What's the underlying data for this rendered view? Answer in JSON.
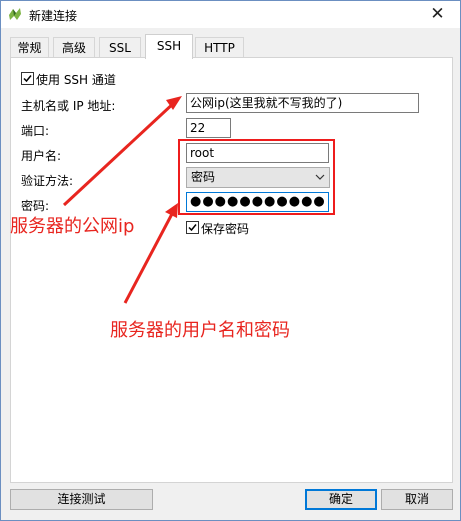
{
  "window": {
    "title": "新建连接",
    "close_glyph": "✕"
  },
  "tabs": [
    {
      "label": "常规"
    },
    {
      "label": "高级"
    },
    {
      "label": "SSL"
    },
    {
      "label": "SSH"
    },
    {
      "label": "HTTP"
    }
  ],
  "active_tab": "SSH",
  "ssh": {
    "use_ssh_label": "使用 SSH 通道",
    "use_ssh_checked": true,
    "host_label": "主机名或 IP 地址:",
    "host_value": "公网ip(这里我就不写我的了)",
    "port_label": "端口:",
    "port_value": "22",
    "username_label": "用户名:",
    "username_value": "root",
    "auth_label": "验证方法:",
    "auth_value": "密码",
    "password_label": "密码:",
    "password_value": "●●●●●●●●●●●",
    "save_password_label": "保存密码",
    "save_password_checked": true
  },
  "buttons": {
    "test": "连接测试",
    "ok": "确定",
    "cancel": "取消"
  },
  "annotations": {
    "server_ip": "服务器的公网ip",
    "user_pass": "服务器的用户名和密码",
    "color": "#e8251f"
  },
  "colors": {
    "accent": "#0078d7",
    "annotation_red": "#ee1c1c"
  }
}
